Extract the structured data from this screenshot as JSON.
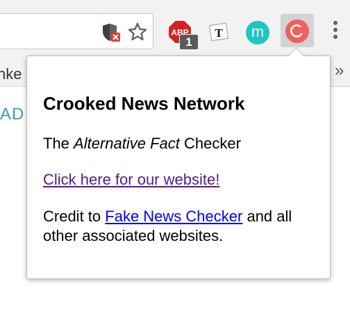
{
  "toolbar": {
    "icons": {
      "shield": "shield-blocked-icon",
      "star": "bookmark-star-icon",
      "menu": "more-vertical-icon"
    },
    "extensions": {
      "adblock": {
        "label": "ABP",
        "badge": "1",
        "color": "#d42222"
      },
      "t_ext": {
        "label": "T"
      },
      "m_ext": {
        "label": "m",
        "color": "#1ec6c2"
      },
      "crooked_ext": {
        "color": "#f2605b",
        "active": true
      }
    }
  },
  "bookmarks_bar": {
    "visible_item_fragment": "nke",
    "overflow_label": "»"
  },
  "page": {
    "visible_text_fragment": "AD"
  },
  "popup": {
    "title": "Crooked News Network",
    "tagline_prefix": "The ",
    "tagline_emphasis": "Alternative Fact",
    "tagline_suffix": " Checker",
    "website_link": "Click here for our website!",
    "credit_prefix": "Credit to ",
    "credit_link": "Fake News Checker",
    "credit_suffix": " and all other associated websites.",
    "link_visited_color": "#551a8b",
    "link_color": "#0000ee"
  }
}
